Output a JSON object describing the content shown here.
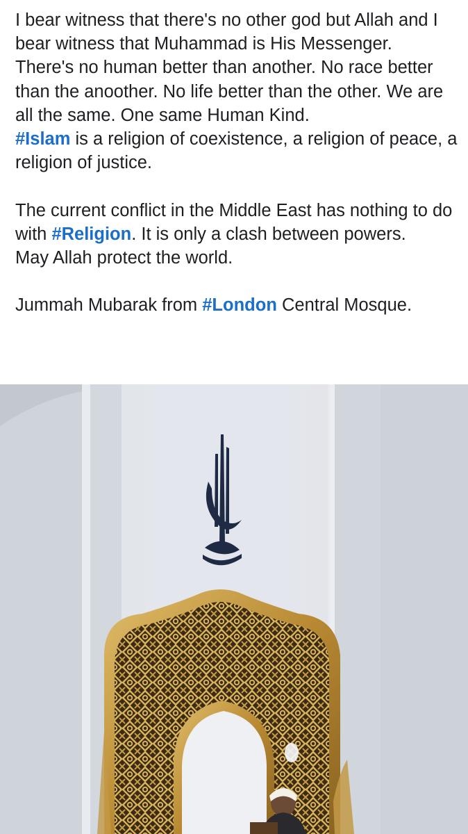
{
  "post": {
    "paragraph1": {
      "line1": "I bear witness that there's no other god but Allah and I bear witness that Muhammad is His Messenger.",
      "line2": "There's no human better than another. No race better than the anoother. No life better than the other. We are all the same. One same Human Kind.",
      "line3_tag": "#Islam",
      "line3_rest": " is a religion of coexistence, a religion of peace, a religion of justice."
    },
    "paragraph2": {
      "line1_before": "The current conflict in the Middle East has nothing to do with ",
      "line1_tag": "#Religion",
      "line1_after": ". It is only a clash between powers.",
      "line2": "May Allah protect the world."
    },
    "paragraph3": {
      "before": "Jummah Mubarak from ",
      "tag": "#London",
      "after": " Central Mosque."
    }
  },
  "colors": {
    "text": "#1c1e21",
    "hashtag": "#1b6fc8",
    "background": "#ffffff"
  },
  "photo": {
    "subject": "mosque-minbar-photo"
  }
}
